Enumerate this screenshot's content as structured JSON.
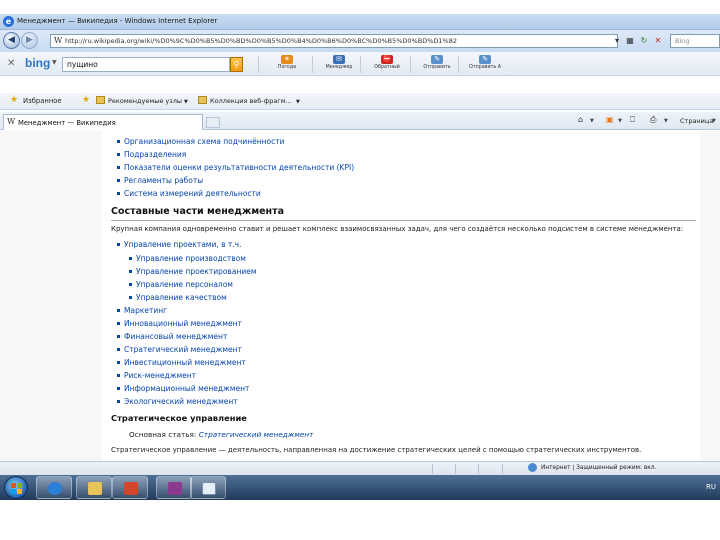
{
  "window": {
    "title": "Менеджмент — Википедия - Windows Internet Explorer"
  },
  "address_bar": {
    "url": "http://ru.wikipedia.org/wiki/%D0%9C%D0%B5%D0%BD%D0%B5%D0%B4%D0%B6%D0%BC%D0%B5%D0%BD%D1%82",
    "search_placeholder": "Bing"
  },
  "bing_toolbar": {
    "logo": "bing",
    "search_value": "пущино",
    "buttons": [
      {
        "label": "Погода",
        "color": "#e88a1a"
      },
      {
        "label": "Менеджер",
        "color": "#3a6fb8"
      },
      {
        "label": "Обратный",
        "color": "#c8281f"
      },
      {
        "label": "Отправить",
        "color": "#5b8fc9"
      },
      {
        "label": "Отправить А",
        "color": "#5b8fc9"
      }
    ]
  },
  "favorites_bar": {
    "label": "Избранное",
    "items": [
      "Рекомендуемые узлы",
      "Коллекция веб-фрагм..."
    ]
  },
  "tab": {
    "title": "Менеджмент — Википедия"
  },
  "command_bar": {
    "page_label": "Страница"
  },
  "article": {
    "top_list": [
      {
        "text": "Организационная схема подчинённости"
      },
      {
        "text": "Подразделения"
      },
      {
        "text": "Показатели оценки результативности деятельности",
        "suffix": " (KPI)"
      },
      {
        "text": "Регламенты работы"
      },
      {
        "text": "Система измерений деятельности"
      }
    ],
    "section1_heading": "Составные части менеджмента",
    "section1_para": "Крупная компания одновременно ставит и решает комплекс взаимосвязанных задач, для чего создаётся несколько подсистем в системе менеджмента:",
    "project_mgmt": "Управление проектами, в т.ч.",
    "sub_list": [
      "Управление производством",
      "Управление проектированием",
      "Управление персоналом",
      "Управление качеством"
    ],
    "list2": [
      "Маркетинг",
      "Инновационный менеджмент",
      "Финансовый менеджмент",
      "Стратегический менеджмент",
      "Инвестиционный менеджмент",
      "Риск-менеджмент",
      "Информационный менеджмент",
      "Экологический менеджмент"
    ],
    "section2_heading": "Стратегическое управление",
    "main_article_prefix": "Основная статья:",
    "main_article_link": "Стратегический менеджмент",
    "section2_para": "Стратегическое управление — деятельность, направленная на достижение стратегических целей с помощью стратегических инструментов."
  },
  "status_bar": {
    "text": "Интернет | Защищенный режим: вкл."
  },
  "taskbar": {
    "language": "RU",
    "apps": [
      {
        "name": "ie",
        "color": "#2a7fd6"
      },
      {
        "name": "explorer",
        "color": "#e8c35a"
      },
      {
        "name": "media",
        "color": "#d2472a"
      },
      {
        "name": "winrar",
        "color": "#8a3b8f"
      },
      {
        "name": "document",
        "color": "#e6eef7"
      }
    ]
  }
}
